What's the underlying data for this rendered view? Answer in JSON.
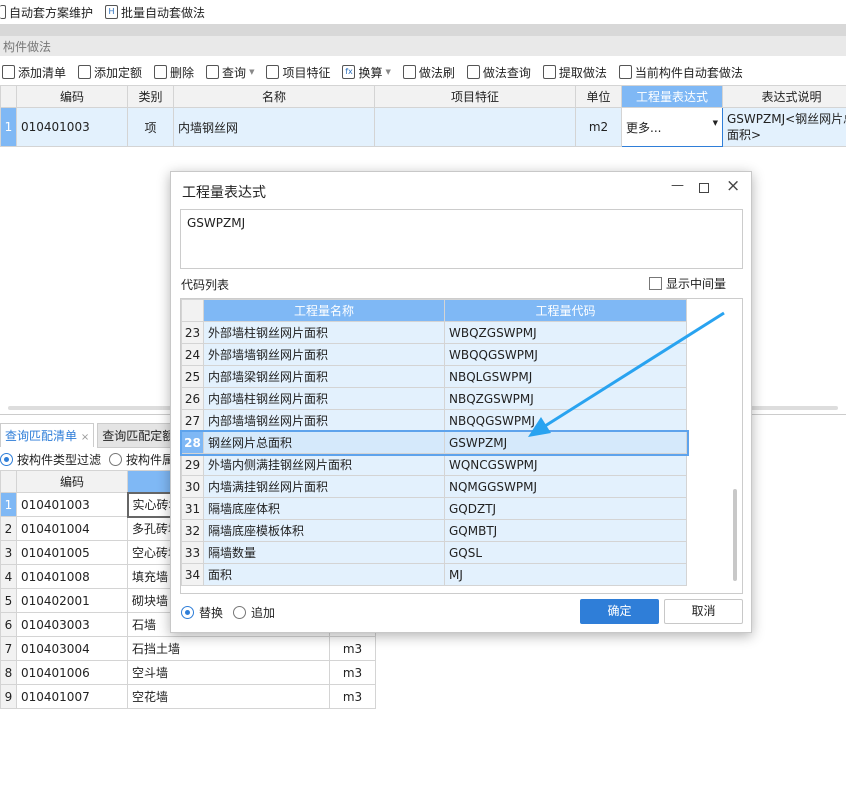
{
  "top_toolbar": {
    "items": [
      "自动套方案维护",
      "批量自动套做法"
    ]
  },
  "panel_title": "构件做法",
  "toolbar": {
    "items": [
      {
        "label": "添加清单",
        "icon": "add-list-icon"
      },
      {
        "label": "添加定额",
        "icon": "add-quota-icon"
      },
      {
        "label": "删除",
        "icon": "delete-icon"
      },
      {
        "label": "查询",
        "icon": "query-icon",
        "dropdown": true
      },
      {
        "label": "项目特征",
        "icon": "feature-icon"
      },
      {
        "label": "换算",
        "icon": "fx-icon",
        "dropdown": true
      },
      {
        "label": "做法刷",
        "icon": "brush-icon"
      },
      {
        "label": "做法查询",
        "icon": "method-query-icon"
      },
      {
        "label": "提取做法",
        "icon": "extract-icon"
      },
      {
        "label": "当前构件自动套做法",
        "icon": "auto-apply-icon"
      }
    ]
  },
  "main_table": {
    "headers": [
      "编码",
      "类别",
      "名称",
      "项目特征",
      "单位",
      "工程量表达式",
      "表达式说明"
    ],
    "rows": [
      {
        "num": "1",
        "code": "010401003",
        "type": "项",
        "name": "内墙钢丝网",
        "feature": "",
        "unit": "m2",
        "expr": "更多...",
        "desc": "GSWPZMJ<钢丝网片总面积>"
      }
    ]
  },
  "bottom": {
    "tabs": [
      "查询匹配清单",
      "查询匹配定额"
    ],
    "filters": [
      "按构件类型过滤",
      "按构件属"
    ],
    "headers": [
      "编码"
    ],
    "rows": [
      {
        "num": "1",
        "code": "010401003",
        "name": "实心砖墙",
        "unit": ""
      },
      {
        "num": "2",
        "code": "010401004",
        "name": "多孔砖墙",
        "unit": ""
      },
      {
        "num": "3",
        "code": "010401005",
        "name": "空心砖墙",
        "unit": ""
      },
      {
        "num": "4",
        "code": "010401008",
        "name": "填充墙",
        "unit": ""
      },
      {
        "num": "5",
        "code": "010402001",
        "name": "砌块墙",
        "unit": ""
      },
      {
        "num": "6",
        "code": "010403003",
        "name": "石墙",
        "unit": ""
      },
      {
        "num": "7",
        "code": "010403004",
        "name": "石挡土墙",
        "unit": "m3"
      },
      {
        "num": "8",
        "code": "010401006",
        "name": "空斗墙",
        "unit": "m3"
      },
      {
        "num": "9",
        "code": "010401007",
        "name": "空花墙",
        "unit": "m3"
      }
    ]
  },
  "dialog": {
    "title": "工程量表达式",
    "expression": "GSWPZMJ",
    "code_list_label": "代码列表",
    "show_intermediate": "显示中间量",
    "headers": [
      "工程量名称",
      "工程量代码"
    ],
    "rows": [
      {
        "num": "23",
        "name": "外部墙柱钢丝网片面积",
        "code": "WBQZGSWPMJ"
      },
      {
        "num": "24",
        "name": "外部墙墙钢丝网片面积",
        "code": "WBQQGSWPMJ"
      },
      {
        "num": "25",
        "name": "内部墙梁钢丝网片面积",
        "code": "NBQLGSWPMJ"
      },
      {
        "num": "26",
        "name": "内部墙柱钢丝网片面积",
        "code": "NBQZGSWPMJ"
      },
      {
        "num": "27",
        "name": "内部墙墙钢丝网片面积",
        "code": "NBQQGSWPMJ"
      },
      {
        "num": "28",
        "name": "钢丝网片总面积",
        "code": "GSWPZMJ",
        "selected": true
      },
      {
        "num": "29",
        "name": "外墙内侧满挂钢丝网片面积",
        "code": "WQNCGSWPMJ"
      },
      {
        "num": "30",
        "name": "内墙满挂钢丝网片面积",
        "code": "NQMGGSWPMJ"
      },
      {
        "num": "31",
        "name": "隔墙底座体积",
        "code": "GQDZTJ"
      },
      {
        "num": "32",
        "name": "隔墙底座模板体积",
        "code": "GQMBTJ"
      },
      {
        "num": "33",
        "name": "隔墙数量",
        "code": "GQSL"
      },
      {
        "num": "34",
        "name": "面积",
        "code": "MJ"
      }
    ],
    "mode_options": [
      "替换",
      "追加"
    ],
    "ok": "确定",
    "cancel": "取消"
  },
  "colors": {
    "accent": "#2f7ed8",
    "header_blue": "#7fb8f5",
    "row_blue": "#e3f1fd",
    "arrow": "#29a3f0"
  }
}
